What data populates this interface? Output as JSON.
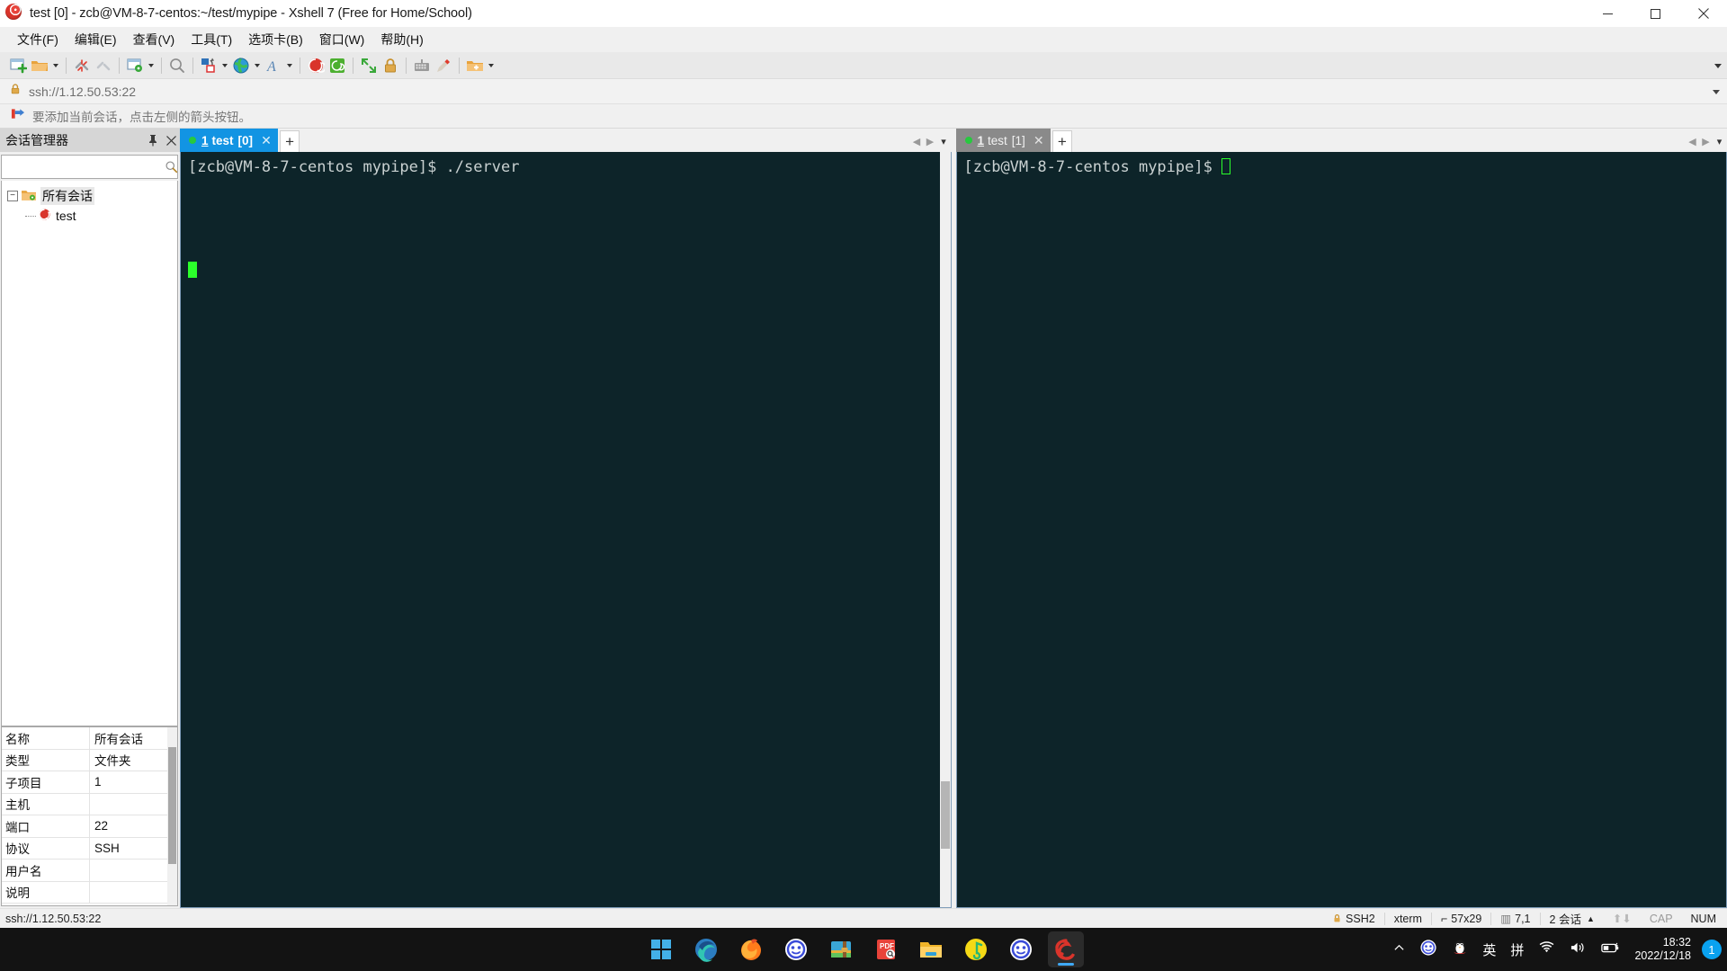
{
  "window": {
    "title": "test [0] - zcb@VM-8-7-centos:~/test/mypipe - Xshell 7 (Free for Home/School)",
    "app_icon": "xshell-logo-icon",
    "minimize_label": "─",
    "maximize_label": "□",
    "close_label": "✕"
  },
  "menubar": {
    "items": [
      {
        "label": "文件(F)",
        "name": "menu-file"
      },
      {
        "label": "编辑(E)",
        "name": "menu-edit"
      },
      {
        "label": "查看(V)",
        "name": "menu-view"
      },
      {
        "label": "工具(T)",
        "name": "menu-tools"
      },
      {
        "label": "选项卡(B)",
        "name": "menu-tabs"
      },
      {
        "label": "窗口(W)",
        "name": "menu-window"
      },
      {
        "label": "帮助(H)",
        "name": "menu-help"
      }
    ]
  },
  "toolbar": {
    "icons": [
      "new-session-icon",
      "open-folder-icon",
      "dropdown-caret",
      "separator",
      "disconnect-icon",
      "reconnect-icon",
      "separator",
      "session-properties-icon",
      "dropdown-caret",
      "separator",
      "find-icon",
      "separator",
      "transfer-file-icon",
      "dropdown-caret",
      "globe-icon",
      "dropdown-caret",
      "font-icon",
      "dropdown-caret",
      "separator",
      "xshell-icon",
      "xftp-icon",
      "separator",
      "fullscreen-icon",
      "lock-icon",
      "separator",
      "keyboard-icon",
      "highlight-icon",
      "separator",
      "add-folder-icon",
      "dropdown-caret"
    ],
    "overflow_caret": "chevron-down-icon"
  },
  "addressbar": {
    "lock_icon": "lock-icon",
    "value": "ssh://1.12.50.53:22",
    "dropdown_icon": "chevron-down-icon"
  },
  "hintbar": {
    "icon": "red-arrow-icon",
    "text": "要添加当前会话，点击左侧的箭头按钮。"
  },
  "session_manager": {
    "title": "会话管理器",
    "pin_icon": "pin-icon",
    "close_icon": "close-icon",
    "search": {
      "value": "",
      "placeholder": "",
      "icon": "search-icon"
    },
    "tree": [
      {
        "label": "所有会话",
        "level": 1,
        "icon": "folder-settings-icon",
        "expander": "−",
        "selected": true
      },
      {
        "label": "test",
        "level": 2,
        "icon": "xshell-session-icon",
        "expander": "",
        "selected": false
      }
    ],
    "properties": {
      "rows": [
        {
          "key": "名称",
          "value": "所有会话"
        },
        {
          "key": "类型",
          "value": "文件夹"
        },
        {
          "key": "子项目",
          "value": "1"
        },
        {
          "key": "主机",
          "value": ""
        },
        {
          "key": "端口",
          "value": "22"
        },
        {
          "key": "协议",
          "value": "SSH"
        },
        {
          "key": "用户名",
          "value": ""
        },
        {
          "key": "说明",
          "value": ""
        }
      ]
    }
  },
  "terminals": [
    {
      "tab": {
        "number": "1",
        "name": "test",
        "index": "[0]",
        "active": true,
        "status_dot": "#27c93f",
        "close_icon": "close-icon",
        "new_tab_label": "+"
      },
      "lines": [
        "[zcb@VM-8-7-centos mypipe]$ ./server"
      ],
      "cursor": {
        "row": 6,
        "col": 0,
        "style": "block"
      },
      "nav": {
        "prev": "◀",
        "next": "▶",
        "menu": "chevron-down-icon"
      }
    },
    {
      "tab": {
        "number": "1",
        "name": "test",
        "index": "[1]",
        "active": false,
        "status_dot": "#27c93f",
        "close_icon": "close-icon",
        "new_tab_label": "+"
      },
      "lines": [
        "[zcb@VM-8-7-centos mypipe]$ "
      ],
      "cursor": {
        "row": 0,
        "col": 28,
        "style": "hollow"
      },
      "nav": {
        "prev": "◀",
        "next": "▶",
        "menu": "chevron-down-icon"
      }
    }
  ],
  "statusbar": {
    "left": "ssh://1.12.50.53:22",
    "cells": [
      {
        "name": "protocol",
        "icon": "lock-icon",
        "label": "SSH2"
      },
      {
        "name": "terminal-type",
        "icon": "",
        "label": "xterm"
      },
      {
        "name": "terminal-size",
        "icon": "size-icon",
        "label": "57x29"
      },
      {
        "name": "cursor-position",
        "icon": "cursor-icon",
        "label": "7,1"
      },
      {
        "name": "session-count",
        "icon": "",
        "label": "2 会话",
        "caret": "▲"
      },
      {
        "name": "transfer-indicator",
        "icon": "up-down-arrows-icon",
        "label": ""
      },
      {
        "name": "caps-lock",
        "icon": "",
        "label": "CAP",
        "dim": true
      },
      {
        "name": "num-lock",
        "icon": "",
        "label": "NUM",
        "dim": false
      }
    ]
  },
  "taskbar": {
    "icons": [
      {
        "name": "start-button",
        "glyph": "windows-icon",
        "running": false,
        "active": false
      },
      {
        "name": "taskbar-edge",
        "glyph": "edge-icon",
        "running": false,
        "active": false
      },
      {
        "name": "taskbar-firefox",
        "glyph": "firefox-icon",
        "running": true,
        "active": false
      },
      {
        "name": "taskbar-browser-2",
        "glyph": "circle-face-icon",
        "running": true,
        "active": false
      },
      {
        "name": "taskbar-winrar",
        "glyph": "archive-icon",
        "running": true,
        "active": false
      },
      {
        "name": "taskbar-pdf-reader",
        "glyph": "pdf-icon",
        "running": true,
        "active": false
      },
      {
        "name": "taskbar-file-explorer",
        "glyph": "folder-icon",
        "running": true,
        "active": false
      },
      {
        "name": "taskbar-qq-music",
        "glyph": "music-note-icon",
        "running": true,
        "active": false
      },
      {
        "name": "taskbar-browser-3",
        "glyph": "circle-face-icon",
        "running": true,
        "active": false
      },
      {
        "name": "taskbar-xshell",
        "glyph": "xshell-icon",
        "running": true,
        "active": true
      }
    ],
    "tray": [
      {
        "name": "tray-show-hidden",
        "glyph": "chevron-up-icon",
        "label": ""
      },
      {
        "name": "tray-browser",
        "glyph": "circle-face-icon",
        "label": ""
      },
      {
        "name": "tray-qq",
        "glyph": "penguin-icon",
        "label": ""
      },
      {
        "name": "tray-ime-lang",
        "glyph": "",
        "label": "英"
      },
      {
        "name": "tray-ime-pinyin",
        "glyph": "",
        "label": "拼"
      },
      {
        "name": "tray-wifi",
        "glyph": "wifi-icon",
        "label": ""
      },
      {
        "name": "tray-volume",
        "glyph": "speaker-icon",
        "label": ""
      },
      {
        "name": "tray-battery",
        "glyph": "battery-icon",
        "label": ""
      }
    ],
    "clock": {
      "time": "18:32",
      "date": "2022/12/18"
    },
    "notification_badge": "1"
  },
  "colors": {
    "accent": "#1294e3",
    "terminal_bg": "#0d2429",
    "terminal_fg": "#c9d1d1",
    "cursor_green": "#2bff2b",
    "taskbar_bg": "#131313",
    "chrome_bg": "#f0f0f0"
  }
}
